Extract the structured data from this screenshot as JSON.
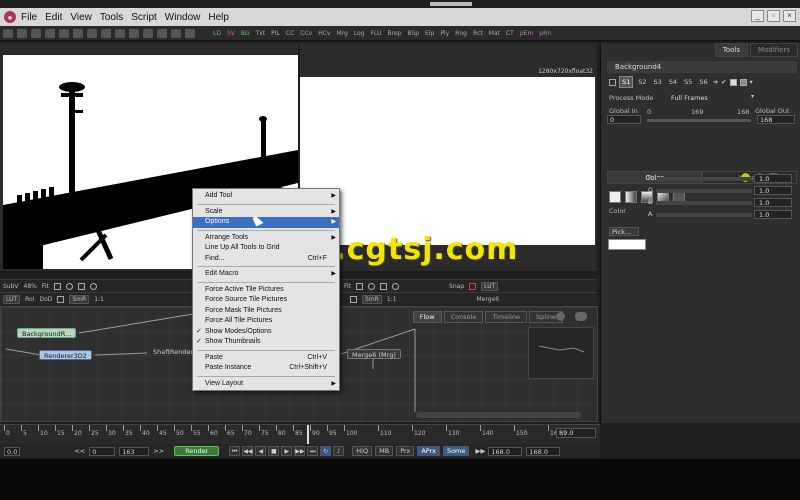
{
  "menubar": {
    "items": [
      "File",
      "Edit",
      "View",
      "Tools",
      "Script",
      "Window",
      "Help"
    ]
  },
  "toolbar": {
    "tools": [
      "LD",
      "SV",
      "BG",
      "Txt",
      "PIL",
      "CC",
      "CCv",
      "HCv",
      "Mrg",
      "Log",
      "FLU",
      "Brep",
      "BSp",
      "Elp",
      "Ply",
      "Rng",
      "Rct",
      "Mat",
      "CT",
      "pEm",
      "pRn"
    ]
  },
  "viewer_right": {
    "resolution": "1280x720xfloat32"
  },
  "viewer_bars": {
    "left_view": "SubV",
    "left_zoom": "48%",
    "left_fit": "Fit",
    "left_lut": "LUT",
    "left_roi": "RoI",
    "left_dod": "DoD",
    "left_smr": "SmR",
    "left_one": "1:1",
    "right_zoom": "Fit",
    "right_snap": "Snap",
    "right_lut": "LUT",
    "right_smr": "SmR",
    "right_one": "1:1",
    "right_node": "Merge6"
  },
  "flow": {
    "tabs": [
      "Flow",
      "Console",
      "Timeline",
      "Spline"
    ],
    "nodes": {
      "background": "BackgroundR...",
      "renderer": "Renderer3D2",
      "shaft": "ShaftRender...",
      "merge": "Merge6 (Mrg)"
    }
  },
  "context_menu": {
    "items": {
      "add_tool": "Add Tool",
      "scale": "Scale",
      "options": "Options",
      "arrange_tools": "Arrange Tools",
      "line_up": "Line Up All Tools to Grid",
      "find": "Find...",
      "find_sc": "Ctrl+F",
      "edit_macro": "Edit Macro",
      "force_active": "Force Active Tile Pictures",
      "force_source": "Force Source Tile Pictures",
      "force_mask": "Force Mask Tile Pictures",
      "force_all": "Force All Tile Pictures",
      "show_modes": "Show Modes/Options",
      "show_thumbs": "Show Thumbnails",
      "paste": "Paste",
      "paste_sc": "Ctrl+V",
      "paste_instance": "Paste Instance",
      "paste_instance_sc": "Ctrl+Shift+V",
      "view_layout": "View Layout"
    }
  },
  "watermark": "www.cgtsj.com",
  "panel": {
    "tabs": [
      "Tools",
      "Modifiers"
    ],
    "tool_name": "Background4",
    "slots": [
      "S1",
      "S2",
      "S3",
      "S4",
      "S5",
      "S6"
    ],
    "process_mode_label": "Process Mode",
    "process_mode_value": "Full Frames",
    "global_in_label": "Global In",
    "global_out_label": "Global Out",
    "global_in_value": "0",
    "global_out_value": "168",
    "range_start": "0",
    "range_mid": "169",
    "range_end": "168",
    "subtabs": [
      "Color",
      "Image"
    ],
    "color_label": "Color",
    "pick_label": "Pick...",
    "channels": [
      {
        "name": "R",
        "value": "1.0"
      },
      {
        "name": "G",
        "value": "1.0"
      },
      {
        "name": "B",
        "value": "1.0"
      },
      {
        "name": "A",
        "value": "1.0"
      }
    ]
  },
  "timeline": {
    "ticks": [
      "0",
      "5",
      "10",
      "15",
      "20",
      "25",
      "30",
      "35",
      "40",
      "45",
      "50",
      "55",
      "60",
      "65",
      "70",
      "75",
      "80",
      "85",
      "90",
      "95",
      "100",
      "110",
      "120",
      "130",
      "140",
      "150",
      "160"
    ],
    "end_value": "89.0"
  },
  "transport": {
    "start": "0.0",
    "range_prev": "<<",
    "range_in": "0",
    "range_out": "163",
    "range_next": ">>",
    "render_label": "Render",
    "hiq": "HiQ",
    "mb": "MB",
    "prx": "Prx",
    "aprx": "APrx",
    "some": "Some",
    "end": "168.0",
    "end2": "168.0"
  },
  "colors": {
    "highlight": "#3a6fc4",
    "watermark": "#f2e600",
    "render_button": "#3a7a3a"
  }
}
